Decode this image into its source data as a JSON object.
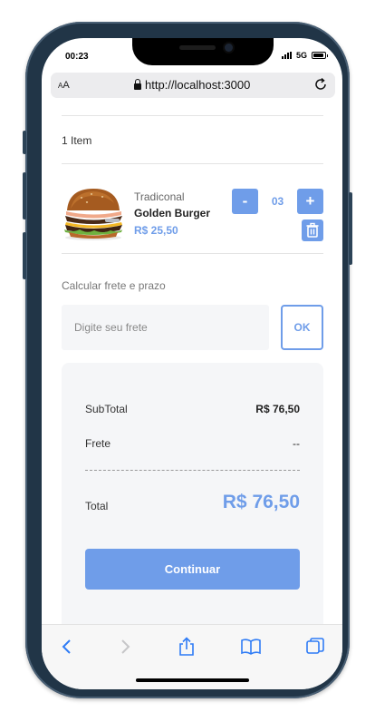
{
  "status_bar": {
    "time": "00:23",
    "network": "5G"
  },
  "browser": {
    "aa_label": "AA",
    "url": "http://localhost:3000"
  },
  "cart": {
    "item_count": "1 Item",
    "product": {
      "category": "Tradiconal",
      "name": "Golden Burger",
      "price": "R$ 25,50",
      "quantity": "03",
      "minus_label": "-",
      "plus_label": "+"
    }
  },
  "shipping": {
    "label": "Calcular frete e prazo",
    "placeholder": "Digite seu frete",
    "ok_label": "OK"
  },
  "summary": {
    "subtotal_label": "SubTotal",
    "subtotal_value": "R$ 76,50",
    "shipping_label": "Frete",
    "shipping_value": "--",
    "total_label": "Total",
    "total_value": "R$ 76,50",
    "continue_label": "Continuar"
  },
  "colors": {
    "accent": "#6f9de9",
    "frame": "#213547",
    "panel": "#f5f6f8"
  },
  "icons": [
    "lock-icon",
    "reload-icon",
    "trash-icon",
    "back-icon",
    "forward-icon",
    "share-icon",
    "bookmarks-icon",
    "tabs-icon"
  ]
}
